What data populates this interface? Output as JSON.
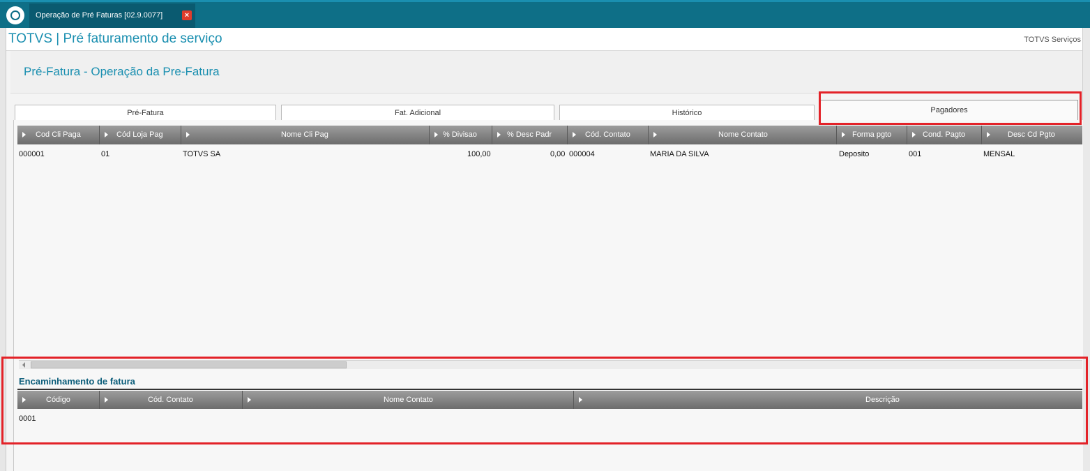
{
  "window": {
    "tab_title": "Operação de Pré Faturas [02.9.0077]",
    "close_glyph": "×"
  },
  "header": {
    "app_title": "TOTVS | Pré faturamento de serviço",
    "right_text": "TOTVS Serviços"
  },
  "panel": {
    "title": "Pré-Fatura - Operação da Pre-Fatura"
  },
  "tabs": [
    {
      "label": "Pré-Fatura"
    },
    {
      "label": "Fat. Adicional"
    },
    {
      "label": "Histórico"
    },
    {
      "label": "Pagadores"
    }
  ],
  "active_tab": "Pagadores",
  "pagadores_grid": {
    "columns": [
      "Cod Cli Paga",
      "Cód Loja Pag",
      "Nome Cli Pag",
      "% Divisao",
      "% Desc Padr",
      "Cód. Contato",
      "Nome Contato",
      "Forma pgto",
      "Cond. Pagto",
      "Desc Cd Pgto"
    ],
    "rows": [
      [
        "000001",
        "01",
        "TOTVS SA",
        "100,00",
        "0,00",
        "000004",
        "MARIA DA SILVA",
        "Deposito",
        "001",
        "MENSAL"
      ]
    ]
  },
  "encaminhamento": {
    "title": "Encaminhamento de fatura",
    "columns": [
      "Código",
      "Cód. Contato",
      "Nome Contato",
      "Descrição"
    ],
    "rows": [
      [
        "0001"
      ]
    ]
  },
  "colors": {
    "topbar": "#0e6f87",
    "accent": "#1a8fb0",
    "highlight": "#e32228",
    "grid_header": "#7a7a7a"
  },
  "icons": {
    "logo": "totvs-logo-icon",
    "close": "close-icon",
    "column_arrow": "triangle-right-icon"
  }
}
